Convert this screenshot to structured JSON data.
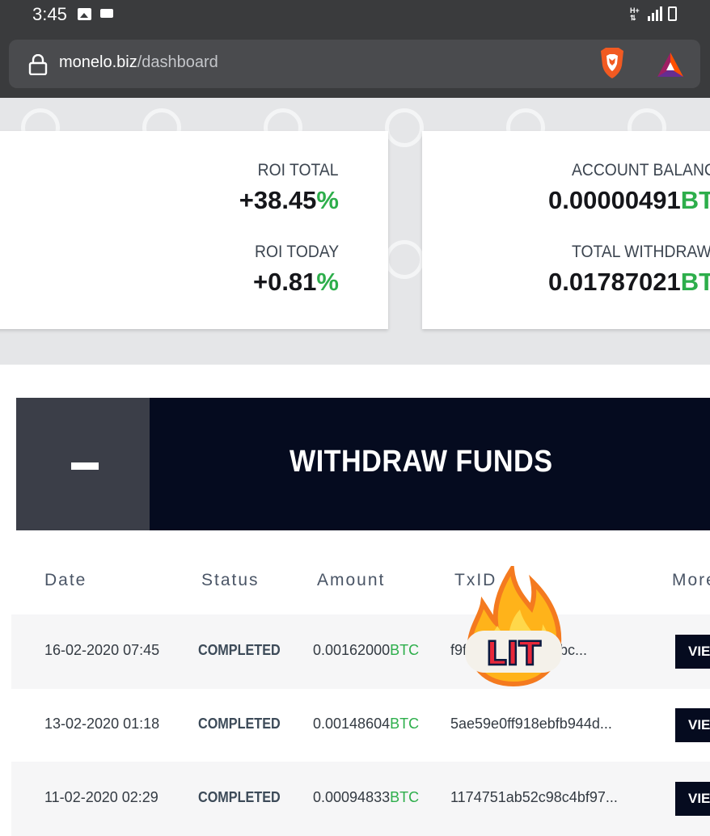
{
  "status_bar": {
    "time": "3:45",
    "network": "H+"
  },
  "browser": {
    "url_domain": "monelo.biz",
    "url_path": "/dashboard"
  },
  "stats": {
    "roi_total": {
      "label": "ROI TOTAL",
      "value": "+38.45",
      "unit": "%"
    },
    "roi_today": {
      "label": "ROI TODAY",
      "value": "+0.81",
      "unit": "%"
    },
    "account_balance": {
      "label": "ACCOUNT BALANC",
      "value": "0.00000491",
      "unit": "BT"
    },
    "total_withdraw": {
      "label": "TOTAL WITHDRAW",
      "value": "0.01787021",
      "unit": "BT"
    }
  },
  "withdraw": {
    "title": "WITHDRAW FUNDS",
    "toggle": "−"
  },
  "table": {
    "headers": {
      "date": "Date",
      "status": "Status",
      "amount": "Amount",
      "txid": "TxID",
      "more": "More"
    },
    "rows": [
      {
        "date": "16-02-2020 07:45",
        "status": "COMPLETED",
        "amount": "0.00162000",
        "unit": "BTC",
        "txid": "f9f                    f8bc...",
        "action": "VIEW"
      },
      {
        "date": "13-02-2020 01:18",
        "status": "COMPLETED",
        "amount": "0.00148604",
        "unit": "BTC",
        "txid": "5ae59e0ff918ebfb944d...",
        "action": "VIEW"
      },
      {
        "date": "11-02-2020 02:29",
        "status": "COMPLETED",
        "amount": "0.00094833",
        "unit": "BTC",
        "txid": "1174751ab52c98c4bf97...",
        "action": "VIEW"
      }
    ]
  },
  "sticker": {
    "text": "LIT"
  },
  "colors": {
    "accent_green": "#2dae4b",
    "header_navy": "#050b1f",
    "toolbar_gray": "#3a3b3d"
  }
}
